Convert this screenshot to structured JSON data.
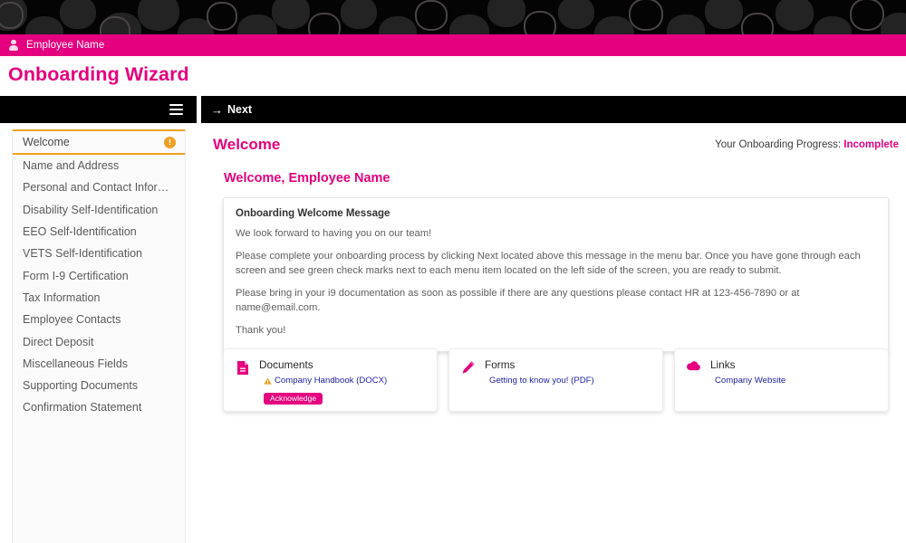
{
  "banner": {
    "icon": "decorative-circles-pattern"
  },
  "user_bar": {
    "icon": "user-icon",
    "name": "Employee Name"
  },
  "page_title": "Onboarding Wizard",
  "menu_bar": {
    "icon": "hamburger-icon"
  },
  "action_bar": {
    "next_arrow": "→",
    "next_label": "Next"
  },
  "sidebar": {
    "items": [
      {
        "label": "Welcome",
        "active": true,
        "badge": "!"
      },
      {
        "label": "Name and Address",
        "active": false
      },
      {
        "label": "Personal and Contact Informat...",
        "active": false
      },
      {
        "label": "Disability Self-Identification",
        "active": false
      },
      {
        "label": "EEO Self-Identification",
        "active": false
      },
      {
        "label": "VETS Self-Identification",
        "active": false
      },
      {
        "label": "Form I-9 Certification",
        "active": false
      },
      {
        "label": "Tax Information",
        "active": false
      },
      {
        "label": "Employee Contacts",
        "active": false
      },
      {
        "label": "Direct Deposit",
        "active": false
      },
      {
        "label": "Miscellaneous Fields",
        "active": false
      },
      {
        "label": "Supporting Documents",
        "active": false
      },
      {
        "label": "Confirmation Statement",
        "active": false
      }
    ]
  },
  "main": {
    "title": "Welcome",
    "progress_label": "Your Onboarding Progress:",
    "progress_value": "Incomplete",
    "welcome_heading": "Welcome, Employee Name",
    "message": {
      "title": "Onboarding Welcome Message",
      "paragraphs": [
        "We look forward to having you on our team!",
        "Please complete your onboarding process by clicking Next located above this message in the menu bar. Once you have gone through each screen and see green check marks next to each menu item located on the left side of the screen, you are ready to submit.",
        "Please bring in your i9 documentation as soon as possible if there are any questions please contact HR at 123-456-7890 or at name@email.com.",
        "Thank you!"
      ]
    },
    "cards": [
      {
        "title": "Documents",
        "icon": "document-icon",
        "link": "Company Handbook (DOCX)",
        "warning_icon": "warning-triangle-icon",
        "badge": "Acknowledge"
      },
      {
        "title": "Forms",
        "icon": "pencil-icon",
        "link": "Getting to know you! (PDF)"
      },
      {
        "title": "Links",
        "icon": "cloud-icon",
        "link": "Company Website"
      }
    ]
  },
  "colors": {
    "brand_magenta": "#e4007e",
    "accent_orange": "#f0a022",
    "link_blue": "#2222aa",
    "toolbar_black": "#000000"
  }
}
